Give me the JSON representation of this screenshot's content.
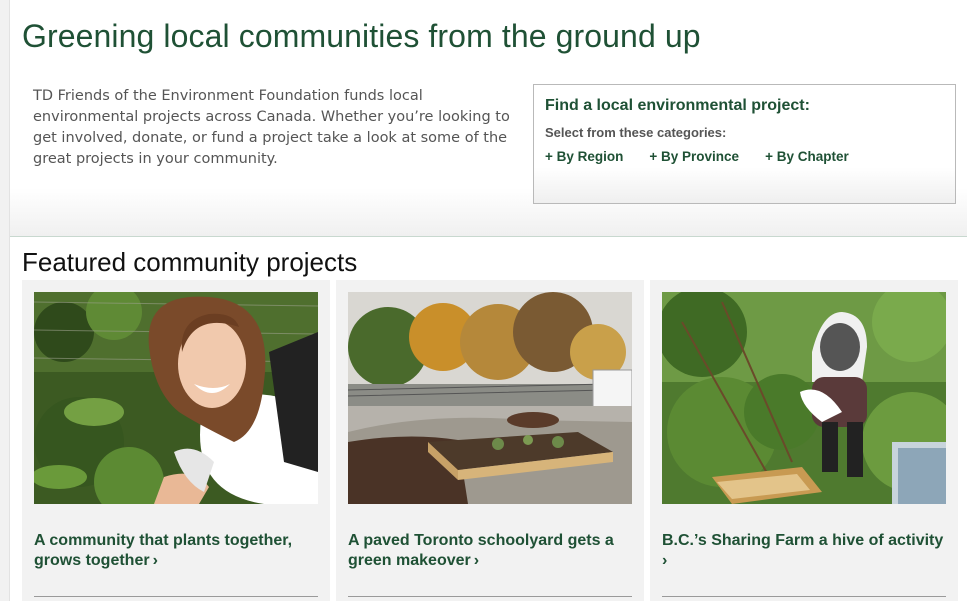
{
  "page": {
    "title": "Greening local communities from the ground up"
  },
  "intro": {
    "text": "TD Friends of the Environment Foundation funds local environmental projects across Canada. Whether you’re looking to get involved, donate, or fund a project take a look at some of the great projects in your community."
  },
  "finder": {
    "title": "Find a local environmental project:",
    "subtitle": "Select from these categories:",
    "links": [
      {
        "label": "+ By Region"
      },
      {
        "label": "+ By Province"
      },
      {
        "label": "+ By Chapter"
      }
    ]
  },
  "featured": {
    "heading": "Featured community projects",
    "cards": [
      {
        "title": "A community that plants together, grows together",
        "chevron": "›"
      },
      {
        "title": "A paved Toronto schoolyard gets a green makeover",
        "chevron": "›"
      },
      {
        "title": "B.C.’s Sharing Farm a hive of activity",
        "chevron": "›"
      }
    ]
  },
  "colors": {
    "brand_green": "#1f5135",
    "body_text": "#555555",
    "card_background": "#f2f2f2"
  }
}
